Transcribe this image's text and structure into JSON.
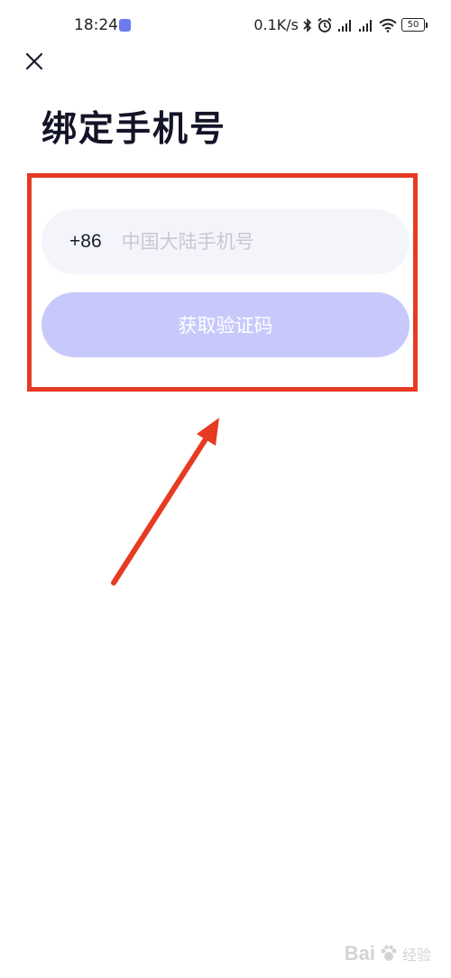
{
  "status_bar": {
    "time": "18:24",
    "network_speed": "0.1K/s",
    "battery_level": "50",
    "icons": [
      "app-notification-icon",
      "bluetooth-icon",
      "alarm-icon",
      "signal-icon",
      "signal-icon",
      "wifi-icon",
      "battery-icon"
    ]
  },
  "header": {
    "close_icon": "close-icon",
    "title": "绑定手机号"
  },
  "form": {
    "country_code": "+86",
    "phone_placeholder": "中国大陆手机号",
    "phone_value": "",
    "submit_label": "获取验证码"
  },
  "colors": {
    "field_background": "#f4f5fb",
    "button_disabled": "#c8c9fb",
    "annotation_red": "#e63a22"
  },
  "watermark": {
    "brand": "Bai",
    "suffix": "经验"
  }
}
